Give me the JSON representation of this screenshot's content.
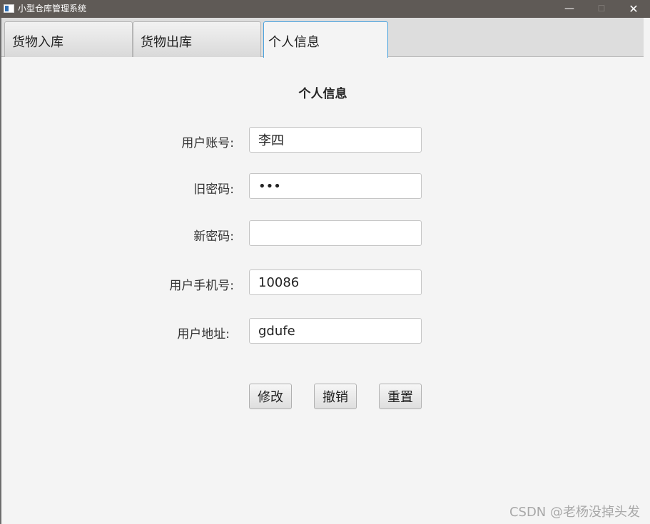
{
  "window": {
    "title": "小型仓库管理系统",
    "minimize_glyph": "—",
    "maximize_glyph": "☐",
    "close_glyph": "✕"
  },
  "tabs": [
    {
      "label": "货物入库",
      "selected": false
    },
    {
      "label": "货物出库",
      "selected": false
    },
    {
      "label": "个人信息",
      "selected": true
    }
  ],
  "form": {
    "title": "个人信息",
    "fields": [
      {
        "label": "用户账号:",
        "value": "李四",
        "type": "text"
      },
      {
        "label": "旧密码:",
        "value": "123",
        "type": "password"
      },
      {
        "label": "新密码:",
        "value": "",
        "type": "password"
      },
      {
        "label": "用户手机号:",
        "value": "10086",
        "type": "text"
      },
      {
        "label": "用户地址:",
        "value": "gdufe",
        "type": "text"
      }
    ],
    "buttons": [
      "修改",
      "撤销",
      "重置"
    ]
  },
  "watermark": "CSDN @老杨没掉头发",
  "colors": {
    "titlebar_bg": "#5f5a56",
    "selected_tab_border": "#4aa3df",
    "background": "#f4f4f4"
  }
}
